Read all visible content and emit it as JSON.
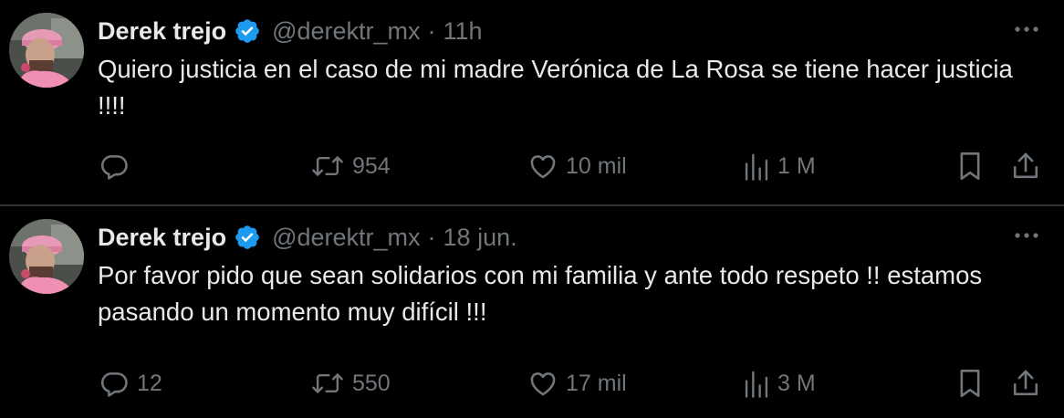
{
  "tweets": [
    {
      "author": {
        "name": "Derek trejo",
        "handle": "@derektr_mx",
        "verified": true
      },
      "separator": "·",
      "time": "11h",
      "text": "Quiero justicia en el caso de mi madre Verónica de La Rosa se tiene hacer justicia !!!!",
      "stats": {
        "replies": "",
        "reposts": "954",
        "likes": "10 mil",
        "views": "1 M"
      }
    },
    {
      "author": {
        "name": "Derek trejo",
        "handle": "@derektr_mx",
        "verified": true
      },
      "separator": "·",
      "time": "18 jun.",
      "text": "Por favor pido que sean solidarios con mi familia y ante todo respeto !! estamos pasando un momento muy difícil !!!",
      "stats": {
        "replies": "12",
        "reposts": "550",
        "likes": "17 mil",
        "views": "3 M"
      }
    }
  ],
  "colors": {
    "background": "#000000",
    "primary_text": "#e7e9ea",
    "secondary_text": "#71767b",
    "verified_badge": "#1d9bf0",
    "divider": "#2f3336"
  },
  "icons": {
    "reply": "speech-bubble-icon",
    "repost": "repost-arrows-icon",
    "like": "heart-icon",
    "views": "bar-chart-icon",
    "bookmark": "bookmark-icon",
    "share": "share-upload-icon",
    "more": "more-dots-icon",
    "verified": "verified-badge-icon"
  }
}
